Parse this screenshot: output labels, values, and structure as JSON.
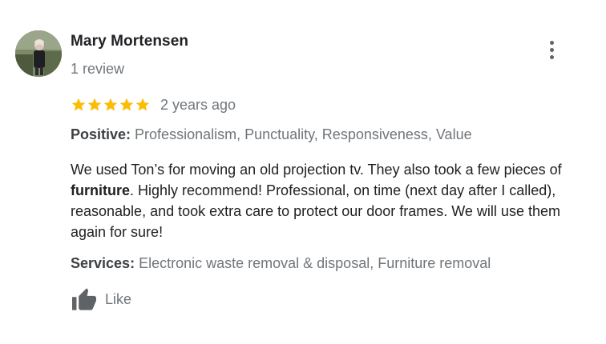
{
  "reviewer": {
    "name": "Mary Mortensen",
    "review_count": "1 review"
  },
  "review": {
    "rating": 5,
    "rating_max": 5,
    "time_ago": "2 years ago",
    "positive_label": "Positive:",
    "positive_values": "Professionalism, Punctuality, Responsiveness, Value",
    "text_part1": "We used Ton’s for moving an old projection tv. They also took a few pieces of ",
    "text_bold": "furniture",
    "text_part2": ". Highly recommend! Professional, on time (next day after I called), reasonable, and took extra care to protect our door frames. We will use them again for sure!",
    "services_label": "Services:",
    "services_values": "Electronic waste removal & disposal, Furniture removal"
  },
  "actions": {
    "like_label": "Like"
  },
  "colors": {
    "star": "#fbbc04",
    "name": "#202124",
    "secondary": "#70757a",
    "icon": "#5f6368"
  },
  "icons": {
    "avatar": "avatar-photo",
    "menu": "more-vert-icon",
    "star": "star-icon",
    "like": "thumb-up-icon"
  }
}
